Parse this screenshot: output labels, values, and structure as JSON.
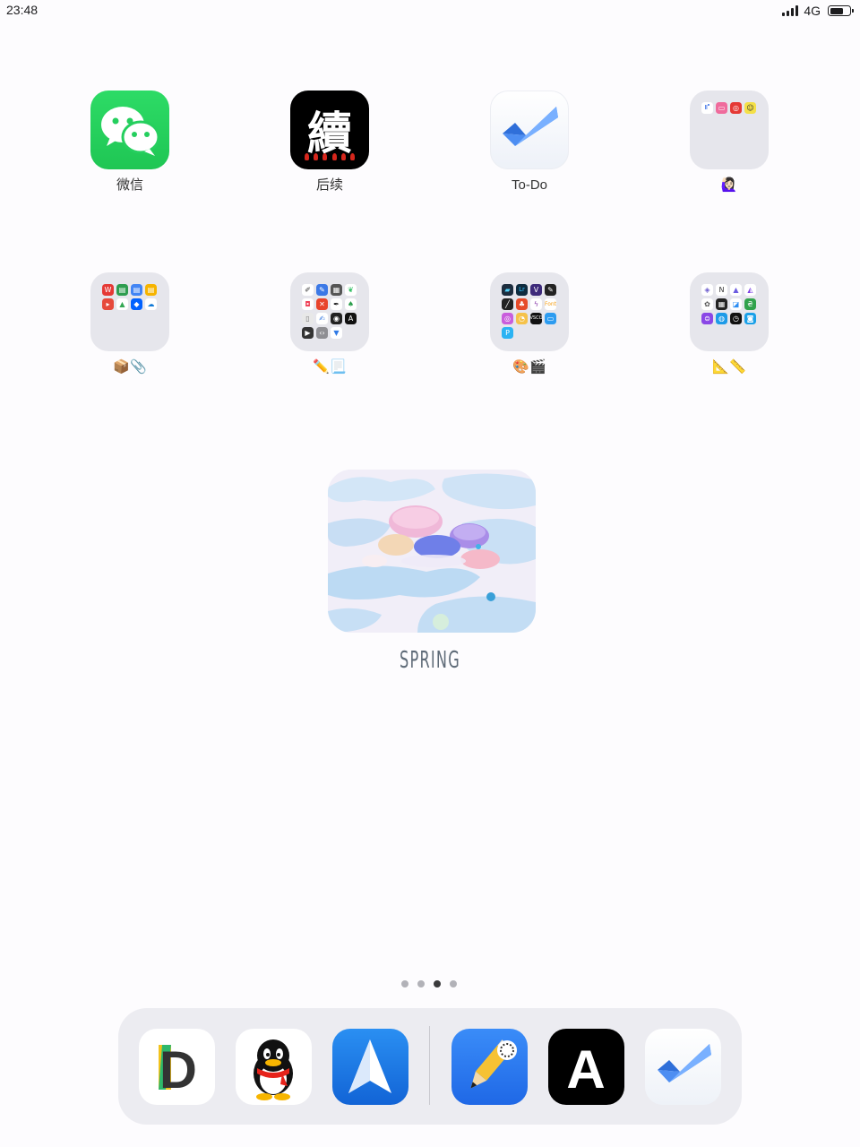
{
  "status_bar": {
    "time": "23:48",
    "network": "4G",
    "battery_level": 0.78,
    "signal_bars": 4
  },
  "home": {
    "row1": [
      {
        "label": "微信",
        "icon": "wechat-icon"
      },
      {
        "label": "后续",
        "icon": "houxu-icon",
        "glyph": "續"
      },
      {
        "label": "To-Do",
        "icon": "todo-check-icon"
      },
      {
        "label": "🙋🏻‍♀️",
        "icon": "folder-icon"
      }
    ],
    "row2": [
      {
        "label": "📦📎",
        "icon": "folder-icon"
      },
      {
        "label": "✏️📃",
        "icon": "folder-icon"
      },
      {
        "label": "🎨🎬",
        "icon": "folder-icon"
      },
      {
        "label": "📐📏",
        "icon": "folder-icon"
      }
    ]
  },
  "widget": {
    "label": "SPRING",
    "image": "spring-shells-illustration"
  },
  "page_indicator": {
    "count": 4,
    "current": 3
  },
  "dock": {
    "apps": [
      {
        "name": "documents-app",
        "icon": "documents-d-icon",
        "letter": "D"
      },
      {
        "name": "qq-app",
        "icon": "qq-penguin-icon"
      },
      {
        "name": "spark-app",
        "icon": "spark-plane-icon"
      },
      {
        "name": "notability-app",
        "icon": "pencil-icon"
      },
      {
        "name": "font-app",
        "icon": "letter-a-icon",
        "letter": "A"
      },
      {
        "name": "todo-app",
        "icon": "todo-check-icon"
      }
    ]
  },
  "colors": {
    "wechat": "#28d463",
    "todo_blue": "#3d7ce8",
    "spark_blue": "#1a78e6",
    "notability_blue": "#2c7cf6",
    "dock_bg": "#ececf1",
    "folder_bg": "#e6e6ec"
  }
}
